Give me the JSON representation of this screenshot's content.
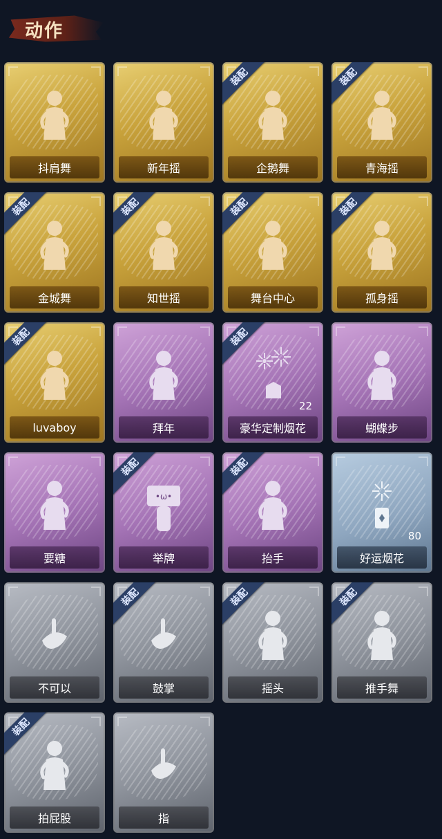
{
  "section_title": "动作",
  "equip_badge": "装配",
  "items": [
    {
      "label": "抖肩舞",
      "tier": "gold",
      "equipped": false,
      "icon": "shoulder-shake-figure-icon"
    },
    {
      "label": "新年摇",
      "tier": "gold",
      "equipped": false,
      "icon": "new-year-sway-figure-icon"
    },
    {
      "label": "企鹅舞",
      "tier": "gold",
      "equipped": true,
      "icon": "penguin-dance-figure-icon"
    },
    {
      "label": "青海摇",
      "tier": "gold",
      "equipped": true,
      "icon": "qinghai-sway-figure-icon"
    },
    {
      "label": "金城舞",
      "tier": "gold",
      "equipped": true,
      "icon": "jincheng-dance-figure-icon"
    },
    {
      "label": "知世摇",
      "tier": "gold",
      "equipped": true,
      "icon": "zhishi-sway-figure-icon"
    },
    {
      "label": "舞台中心",
      "tier": "gold",
      "equipped": true,
      "icon": "stage-center-figure-icon"
    },
    {
      "label": "孤身摇",
      "tier": "gold",
      "equipped": true,
      "icon": "solo-sway-figure-icon"
    },
    {
      "label": "luvaboy",
      "tier": "gold",
      "equipped": true,
      "icon": "luvaboy-figure-icon"
    },
    {
      "label": "拜年",
      "tier": "purple",
      "equipped": false,
      "icon": "new-year-greeting-figure-icon"
    },
    {
      "label": "豪华定制烟花",
      "tier": "purple",
      "equipped": true,
      "icon": "fireworks-box-icon",
      "count": "22"
    },
    {
      "label": "蝴蝶步",
      "tier": "purple",
      "equipped": false,
      "icon": "butterfly-step-figure-icon"
    },
    {
      "label": "要糖",
      "tier": "purple",
      "equipped": false,
      "icon": "ask-candy-figure-icon"
    },
    {
      "label": "举牌",
      "tier": "purple",
      "equipped": true,
      "icon": "hold-sign-figure-icon"
    },
    {
      "label": "抬手",
      "tier": "purple",
      "equipped": true,
      "icon": "raise-hand-figure-icon"
    },
    {
      "label": "好运烟花",
      "tier": "blue",
      "equipped": false,
      "icon": "lucky-firework-canister-icon",
      "count": "80"
    },
    {
      "label": "不可以",
      "tier": "grey",
      "equipped": false,
      "icon": "wagging-finger-icon"
    },
    {
      "label": "鼓掌",
      "tier": "grey",
      "equipped": true,
      "icon": "clapping-hands-icon"
    },
    {
      "label": "摇头",
      "tier": "grey",
      "equipped": true,
      "icon": "shake-head-figure-icon"
    },
    {
      "label": "推手舞",
      "tier": "grey",
      "equipped": true,
      "icon": "push-hand-dance-figure-icon"
    },
    {
      "label": "拍屁股",
      "tier": "grey",
      "equipped": true,
      "icon": "slap-butt-figure-icon"
    },
    {
      "label": "指",
      "tier": "grey",
      "equipped": false,
      "icon": "pointing-hand-icon"
    }
  ],
  "colors": {
    "background": "#0f1624",
    "gold": "#c9a33c",
    "purple": "#a574b6",
    "blue": "#8ea6bf",
    "grey": "#8e939c",
    "badge": "#2b3f66"
  }
}
